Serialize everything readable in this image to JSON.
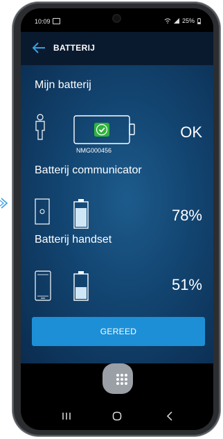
{
  "status": {
    "time": "10:09",
    "battery_pct": "25%"
  },
  "appbar": {
    "title": "BATTERIJ"
  },
  "sections": {
    "my_battery": {
      "title": "Mijn batterij",
      "status": "OK",
      "serial": "NMG000456"
    },
    "communicator": {
      "title": "Batterij communicator",
      "level": "78%",
      "level_fraction": 0.78
    },
    "handset": {
      "title": "Batterij handset",
      "level": "51%",
      "level_fraction": 0.51
    }
  },
  "actions": {
    "done_label": "GEREED"
  },
  "colors": {
    "accent": "#1d8fd6",
    "ok_green": "#2eb33c",
    "appbar": "#0a1a2e"
  },
  "icons": [
    "arrow-left-icon",
    "person-icon",
    "battery-ok-icon",
    "device-icon",
    "phone-icon",
    "apps-grid-icon"
  ]
}
